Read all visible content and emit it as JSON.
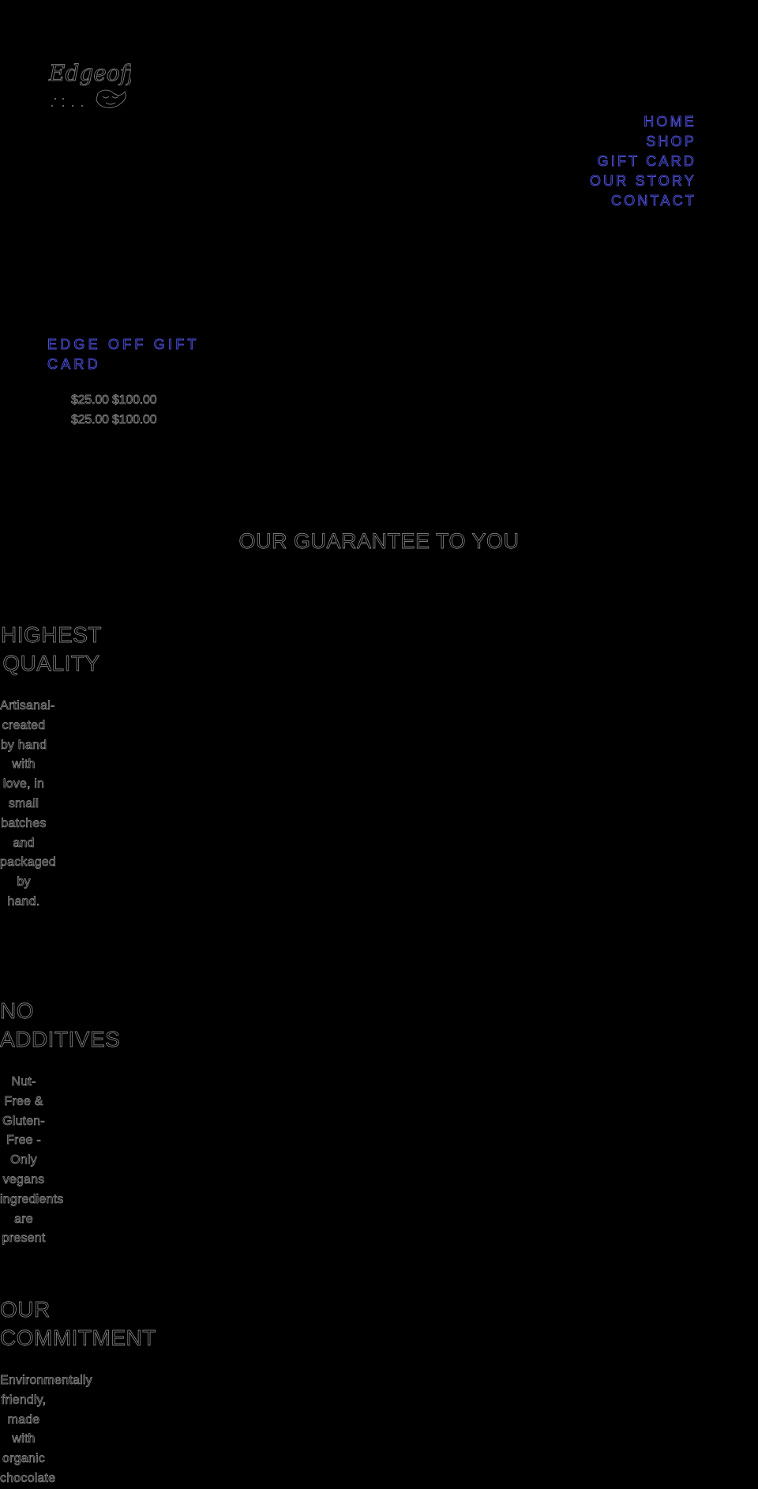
{
  "brand": {
    "logo_text": "Edge off",
    "logo_icon": "chocolate-logo-icon"
  },
  "nav": {
    "items": [
      {
        "label": "HOME"
      },
      {
        "label": "SHOP"
      },
      {
        "label": "GIFT CARD"
      },
      {
        "label": "OUR STORY"
      },
      {
        "label": "CONTACT"
      }
    ]
  },
  "product": {
    "title": "EDGE OFF GIFT CARD",
    "price_ranges": [
      "$25.00 $100.00",
      "$25.00 $100.00"
    ]
  },
  "guarantee": {
    "title": "OUR GUARANTEE TO YOU",
    "features": [
      {
        "title": "HIGHEST QUALITY",
        "text": "Artisanal-created by hand with love, in small batches and packaged by hand."
      },
      {
        "title": "NO ADDITIVES",
        "text": "Nut-Free & Gluten-Free - Only vegans ingredients are present"
      },
      {
        "title": "OUR COMMITMENT",
        "text": "Environmentally friendly, made with organic chocolate"
      }
    ]
  },
  "colors": {
    "background": "#000000",
    "accent_blue": "#5a5cff",
    "text_grey": "#9a9a9a"
  }
}
